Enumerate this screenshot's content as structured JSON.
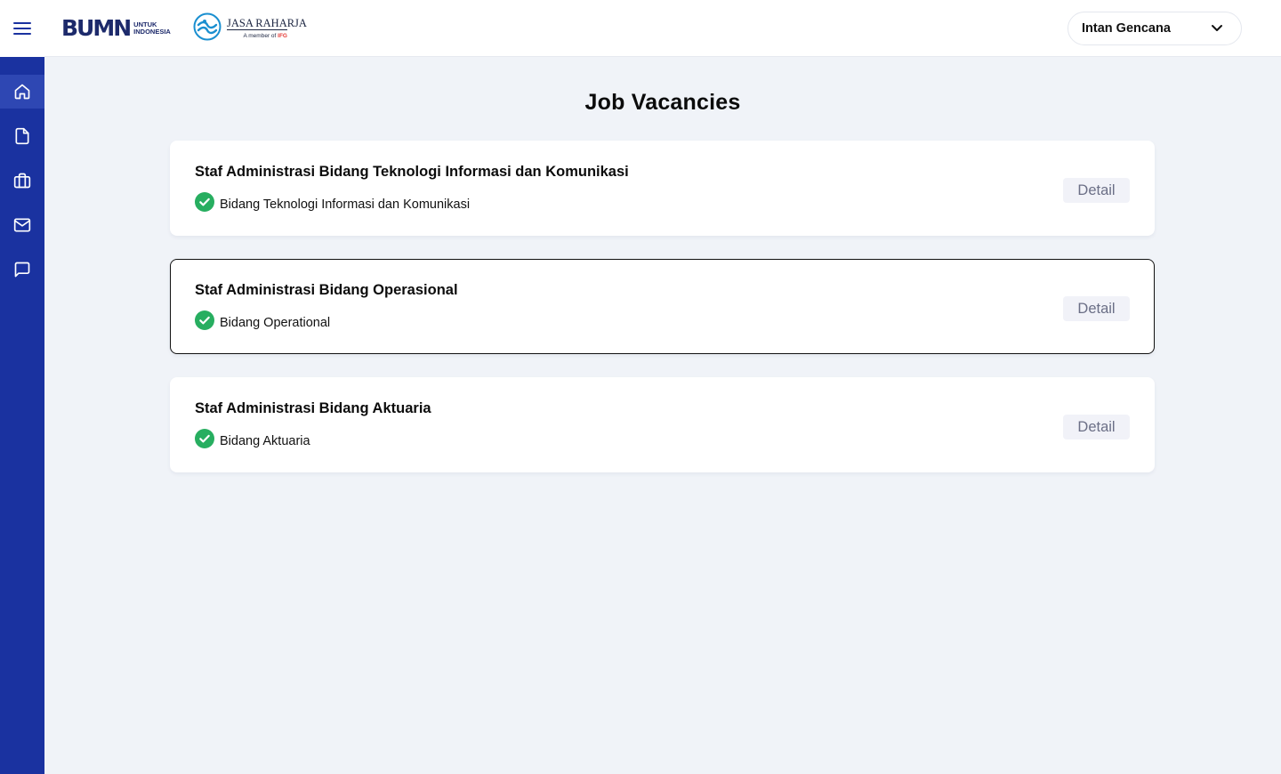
{
  "brand": {
    "bumn_mark": "BUMN",
    "bumn_tag_line1": "UNTUK",
    "bumn_tag_line2": "INDONESIA",
    "jasa_raharja_name": "JASA RAHARJA",
    "jasa_raharja_member_prefix": "A member of",
    "jasa_raharja_member_group": "IFG"
  },
  "sidebar": {
    "menu_icon": "hamburger-icon",
    "items": [
      {
        "icon": "home-icon",
        "active": true
      },
      {
        "icon": "document-icon",
        "active": false
      },
      {
        "icon": "briefcase-icon",
        "active": false
      },
      {
        "icon": "mail-icon",
        "active": false
      },
      {
        "icon": "chat-icon",
        "active": false
      }
    ],
    "colors": {
      "background": "#1a32a0",
      "active": "#2e47b3"
    }
  },
  "header": {
    "user_name": "Intan Gencana",
    "user_dropdown_icon": "chevron-down-icon"
  },
  "main": {
    "title": "Job Vacancies",
    "jobs": [
      {
        "title": "Staf Administrasi Bidang Teknologi Informasi dan Komunikasi",
        "department": "Bidang Teknologi Informasi dan Komunikasi",
        "detail_label": "Detail",
        "selected": false
      },
      {
        "title": "Staf Administrasi Bidang Operasional",
        "department": "Bidang Operational",
        "detail_label": "Detail",
        "selected": true
      },
      {
        "title": "Staf Administrasi Bidang Aktuaria",
        "department": "Bidang Aktuaria",
        "detail_label": "Detail",
        "selected": false
      }
    ]
  },
  "colors": {
    "check": "#27ae60",
    "page_background": "#f0f3f8"
  }
}
